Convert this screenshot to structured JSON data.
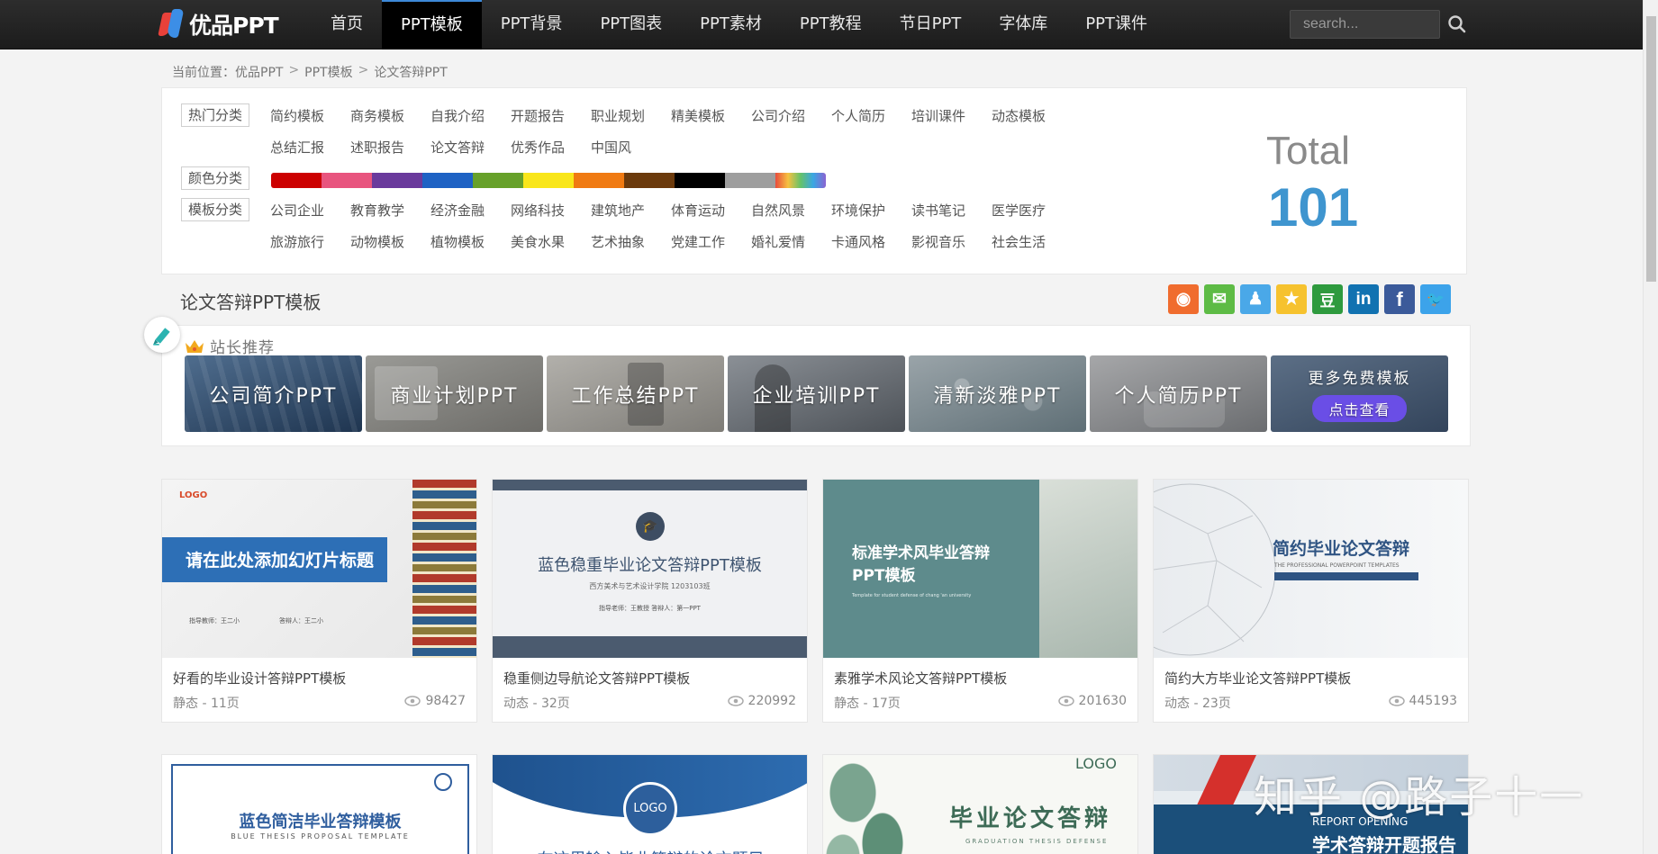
{
  "brand": {
    "logo_text": "优品PPT"
  },
  "nav": {
    "items": [
      {
        "label": "首页"
      },
      {
        "label": "PPT模板"
      },
      {
        "label": "PPT背景"
      },
      {
        "label": "PPT图表"
      },
      {
        "label": "PPT素材"
      },
      {
        "label": "PPT教程"
      },
      {
        "label": "节日PPT"
      },
      {
        "label": "字体库"
      },
      {
        "label": "PPT课件"
      }
    ],
    "active": "PPT模板",
    "search_placeholder": "search..."
  },
  "breadcrumb": {
    "prefix": "当前位置：",
    "items": [
      "优品PPT",
      "PPT模板",
      "论文答辩PPT"
    ],
    "separator": ">"
  },
  "filters": {
    "hot": {
      "tag": "热门分类",
      "row1": [
        "简约模板",
        "商务模板",
        "自我介绍",
        "开题报告",
        "职业规划",
        "精美模板",
        "公司介绍",
        "个人简历",
        "培训课件",
        "动态模板"
      ],
      "row2": [
        "总结汇报",
        "述职报告",
        "论文答辩",
        "优秀作品",
        "中国风"
      ]
    },
    "color": {
      "tag": "颜色分类",
      "swatches": [
        "#cc0000",
        "#e8547e",
        "#6a3a9c",
        "#1e62c4",
        "#67a12a",
        "#f9e61a",
        "#f07a12",
        "#6b3a0c",
        "#000000",
        "#9e9e9e",
        "rainbow"
      ]
    },
    "template": {
      "tag": "模板分类",
      "row1": [
        "公司企业",
        "教育教学",
        "经济金融",
        "网络科技",
        "建筑地产",
        "体育运动",
        "自然风景",
        "环境保护",
        "读书笔记",
        "医学医疗"
      ],
      "row2": [
        "旅游旅行",
        "动物模板",
        "植物模板",
        "美食水果",
        "艺术抽象",
        "党建工作",
        "婚礼爱情",
        "卡通风格",
        "影视音乐",
        "社会生活"
      ]
    },
    "total_label": "Total",
    "total_value": "101"
  },
  "section": {
    "title": "论文答辩PPT模板"
  },
  "share": [
    {
      "name": "weibo",
      "glyph": "◉",
      "color": "#f06c2e"
    },
    {
      "name": "wechat",
      "glyph": "✉",
      "color": "#5dbb45"
    },
    {
      "name": "qq",
      "glyph": "♟",
      "color": "#4aa8e8"
    },
    {
      "name": "qzone",
      "glyph": "★",
      "color": "#f6c22e"
    },
    {
      "name": "douban",
      "glyph": "豆",
      "color": "#2e9a3e"
    },
    {
      "name": "linkedin",
      "glyph": "in",
      "color": "#1172b1"
    },
    {
      "name": "facebook",
      "glyph": "f",
      "color": "#3b5a9a"
    },
    {
      "name": "twitter",
      "glyph": "🐦",
      "color": "#3ca3ea"
    }
  ],
  "recommend": {
    "title": "站长推荐",
    "tiles": [
      "公司简介PPT",
      "商业计划PPT",
      "工作总结PPT",
      "企业培训PPT",
      "清新淡雅PPT",
      "个人简历PPT"
    ],
    "more_text": "更多免费模板",
    "more_cta": "点击查看"
  },
  "cards": [
    {
      "title": "好看的毕业设计答辩PPT模板",
      "meta": "静态 - 11页",
      "views": "98427",
      "thumb_text": "请在此处添加幻灯片标题",
      "thumb_logo": "LOGO",
      "thumb_sub1": "指导教师：王二小",
      "thumb_sub2": "答辩人：王二小"
    },
    {
      "title": "稳重侧边导航论文答辩PPT模板",
      "meta": "动态 - 32页",
      "views": "220992",
      "thumb_text": "蓝色稳重毕业论文答辩PPT模板",
      "thumb_sub1": "西方美术与艺术设计学院  1203103班",
      "thumb_sub2": "指导老师：王教授     答辩人：第一PPT"
    },
    {
      "title": "素雅学术风论文答辩PPT模板",
      "meta": "静态 - 17页",
      "views": "201630",
      "thumb_text": "标准学术风毕业答辩",
      "thumb_text2": "PPT模板",
      "thumb_sub1": "Template for student defense of chang 'an university"
    },
    {
      "title": "简约大方毕业论文答辩PPT模板",
      "meta": "动态 - 23页",
      "views": "445193",
      "thumb_text": "简约毕业论文答辩",
      "thumb_sub1": "THE PROFESSIONAL POWERPOINT TEMPLATES"
    }
  ],
  "cards_row2": [
    {
      "thumb_text": "蓝色简洁毕业答辩模板",
      "thumb_sub1": "BLUE THESIS PROPOSAL TEMPLATE"
    },
    {
      "thumb_text": "在这里输入毕业答辩的论文题目",
      "thumb_logo": "LOGO"
    },
    {
      "thumb_text": "毕业论文答辩",
      "thumb_sub1": "GRADUATION THESIS DEFENSE",
      "thumb_logo": "LOGO"
    },
    {
      "thumb_text": "学术答辩开题报告",
      "thumb_sub1": "REPORT OPENING"
    }
  ],
  "watermark": "知乎 @路子十一"
}
